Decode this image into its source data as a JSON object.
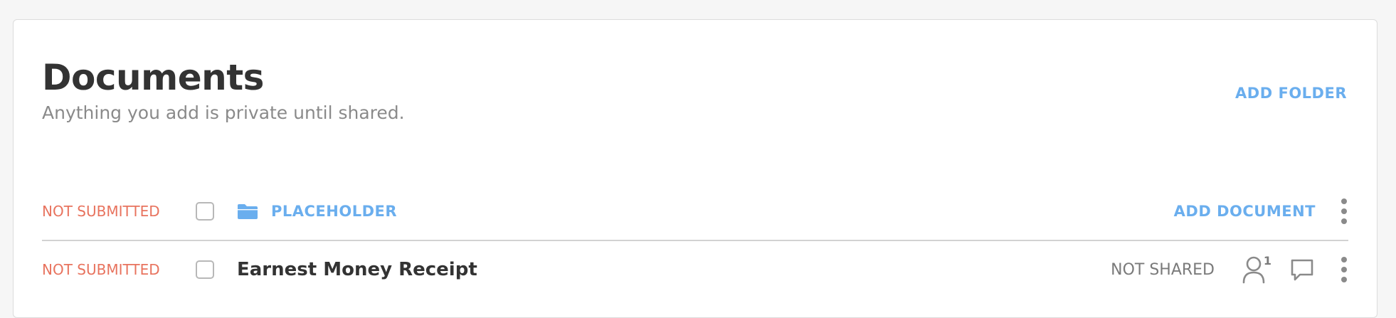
{
  "header": {
    "title": "Documents",
    "subtitle": "Anything you add is private until shared.",
    "add_folder_label": "ADD FOLDER"
  },
  "rows": [
    {
      "type": "folder",
      "status": "NOT SUBMITTED",
      "name": "PLACEHOLDER",
      "icon": "folder-icon",
      "action_label": "ADD DOCUMENT"
    },
    {
      "type": "document",
      "status": "NOT SUBMITTED",
      "name": "Earnest Money Receipt",
      "share_status": "NOT SHARED",
      "participant_count": "1",
      "icons": [
        "user-icon",
        "comment-icon",
        "more-icon"
      ]
    }
  ],
  "colors": {
    "accent": "#6aaeee",
    "status_red": "#e8735e",
    "title": "#333333",
    "muted": "#8a8a8a"
  }
}
